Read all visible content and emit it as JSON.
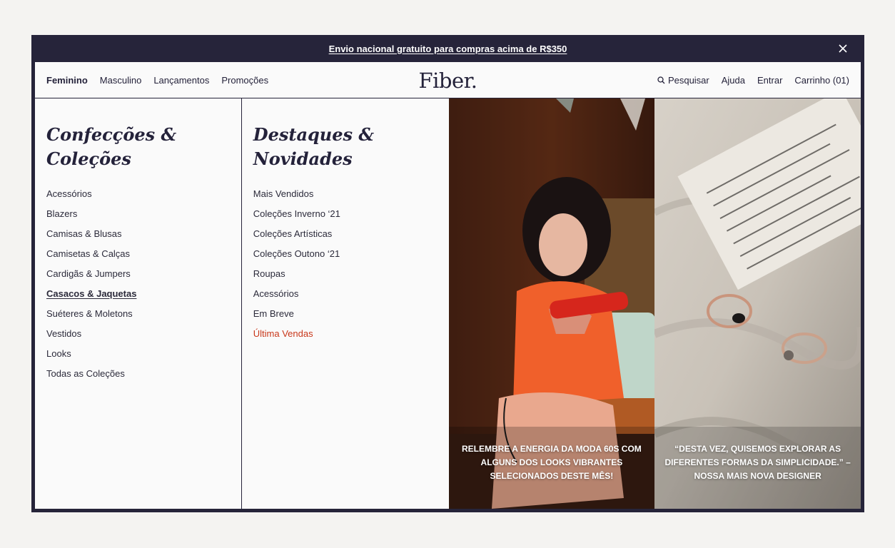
{
  "announcement": {
    "text": "Envio nacional gratuito para compras acima de R$350",
    "close_icon": "close-icon"
  },
  "nav": {
    "left": [
      "Feminino",
      "Masculino",
      "Lançamentos",
      "Promoções"
    ],
    "active": "Feminino",
    "logo": "Fiber.",
    "search_label": "Pesquisar",
    "search_icon": "search-icon",
    "help": "Ajuda",
    "login": "Entrar",
    "cart": "Carrinho (01)"
  },
  "columns": {
    "collections": {
      "title": "Confecções & Coleções",
      "items": [
        "Acessórios",
        "Blazers",
        "Camisas & Blusas",
        "Camisetas & Calças",
        "Cardigãs & Jumpers",
        "Casacos & Jaquetas",
        "Suéteres & Moletons",
        "Vestidos",
        "Looks",
        "Todas as Coleções"
      ],
      "current": "Casacos & Jaquetas"
    },
    "highlights": {
      "title": "Destaques & Novidades",
      "items": [
        "Mais Vendidos",
        "Coleções Inverno ‘21",
        "Coleções Artísticas",
        "Coleções Outono ‘21",
        "Roupas",
        "Acessórios",
        "Em Breve",
        "Última Vendas"
      ],
      "sale_item": "Última Vendas",
      "sale_color": "#c8371a"
    }
  },
  "promos": [
    {
      "caption": "RELEMBRE A ENERGIA DA MODA 60S COM ALGUNS DOS LOOKS VIBRANTES SELECIONADOS DESTE MÊS!"
    },
    {
      "caption": "“DESTA VEZ, QUISEMOS EXPLORAR AS DIFERENTES FORMAS DA SIMPLICIDADE.” – NOSSA MAIS NOVA DESIGNER"
    }
  ],
  "colors": {
    "dark": "#26243a",
    "background": "#fafafa",
    "page": "#f4f3f1",
    "accent_sale": "#c8371a"
  }
}
